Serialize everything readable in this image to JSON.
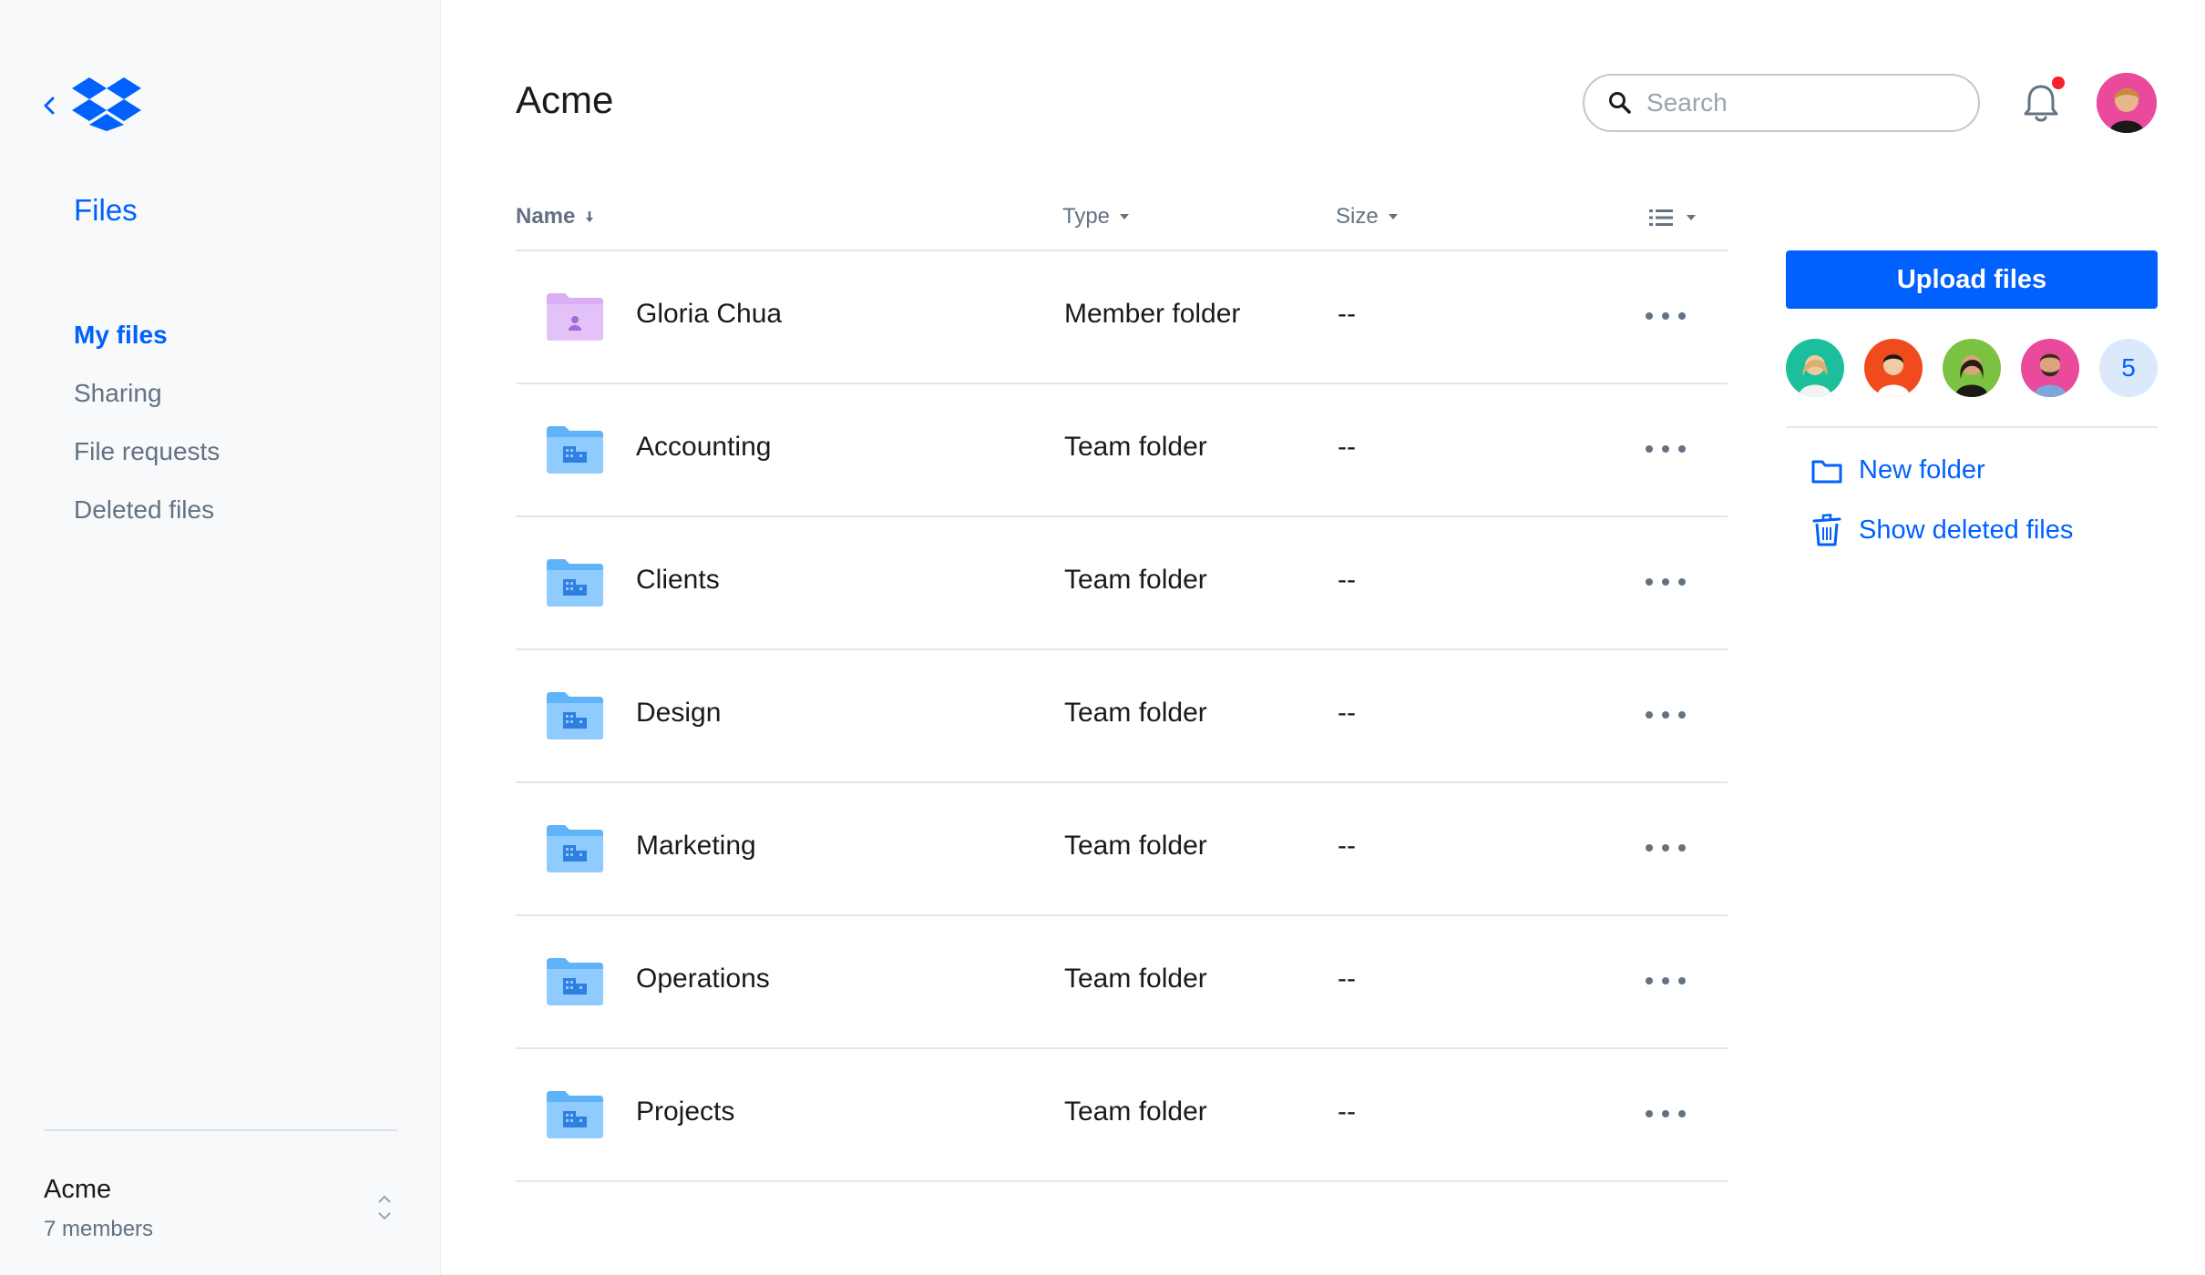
{
  "sidebar": {
    "title": "Files",
    "items": [
      {
        "label": "My files",
        "active": true
      },
      {
        "label": "Sharing"
      },
      {
        "label": "File requests"
      },
      {
        "label": "Deleted files"
      }
    ],
    "team": {
      "name": "Acme",
      "members": "7 members"
    }
  },
  "header": {
    "title": "Acme",
    "search_placeholder": "Search"
  },
  "table": {
    "columns": {
      "name": "Name",
      "type": "Type",
      "size": "Size"
    },
    "rows": [
      {
        "name": "Gloria Chua",
        "type": "Member folder",
        "size": "--",
        "icon": "member-folder-icon"
      },
      {
        "name": "Accounting",
        "type": "Team folder",
        "size": "--",
        "icon": "team-folder-icon"
      },
      {
        "name": "Clients",
        "type": "Team folder",
        "size": "--",
        "icon": "team-folder-icon"
      },
      {
        "name": "Design",
        "type": "Team folder",
        "size": "--",
        "icon": "team-folder-icon"
      },
      {
        "name": "Marketing",
        "type": "Team folder",
        "size": "--",
        "icon": "team-folder-icon"
      },
      {
        "name": "Operations",
        "type": "Team folder",
        "size": "--",
        "icon": "team-folder-icon"
      },
      {
        "name": "Projects",
        "type": "Team folder",
        "size": "--",
        "icon": "team-folder-icon"
      }
    ]
  },
  "panel": {
    "upload_label": "Upload files",
    "more_members_count": "5",
    "actions": {
      "new_folder": "New folder",
      "show_deleted": "Show deleted files"
    }
  },
  "colors": {
    "accent": "#0061fe",
    "sidebar_bg": "#f7f9fa",
    "member_folder": "#d9b0f5",
    "team_folder": "#7fc4fb",
    "notification": "#f5222d"
  }
}
